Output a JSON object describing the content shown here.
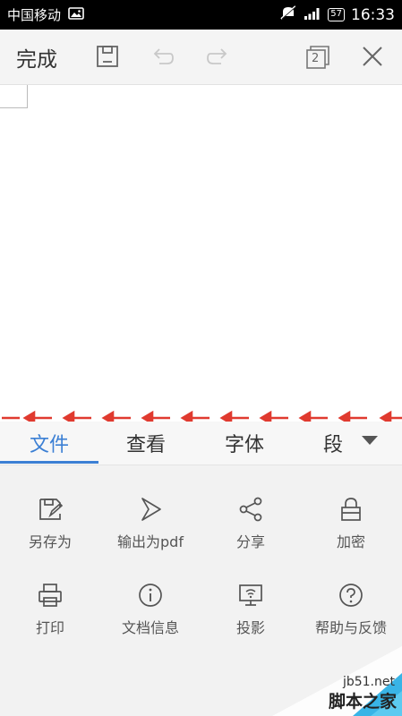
{
  "status_bar": {
    "carrier": "中国移动",
    "battery": "57",
    "time": "16:33"
  },
  "toolbar": {
    "done_label": "完成",
    "window_count": "2",
    "icons": [
      "save-icon",
      "undo-icon",
      "redo-icon",
      "window-switch-icon",
      "close-icon"
    ]
  },
  "tabs": [
    {
      "label": "文件",
      "active": true
    },
    {
      "label": "查看",
      "active": false
    },
    {
      "label": "字体",
      "active": false
    },
    {
      "label": "段",
      "active": false
    }
  ],
  "file_menu": {
    "row1": [
      "另存为",
      "输出为pdf",
      "分享",
      "加密"
    ],
    "row2": [
      "打印",
      "文档信息",
      "投影",
      "帮助与反馈"
    ]
  },
  "watermark": {
    "site": "jb51.net",
    "name": "脚本之家"
  },
  "colors": {
    "accent": "#3b7fd4",
    "arrow": "#e03a2f"
  }
}
